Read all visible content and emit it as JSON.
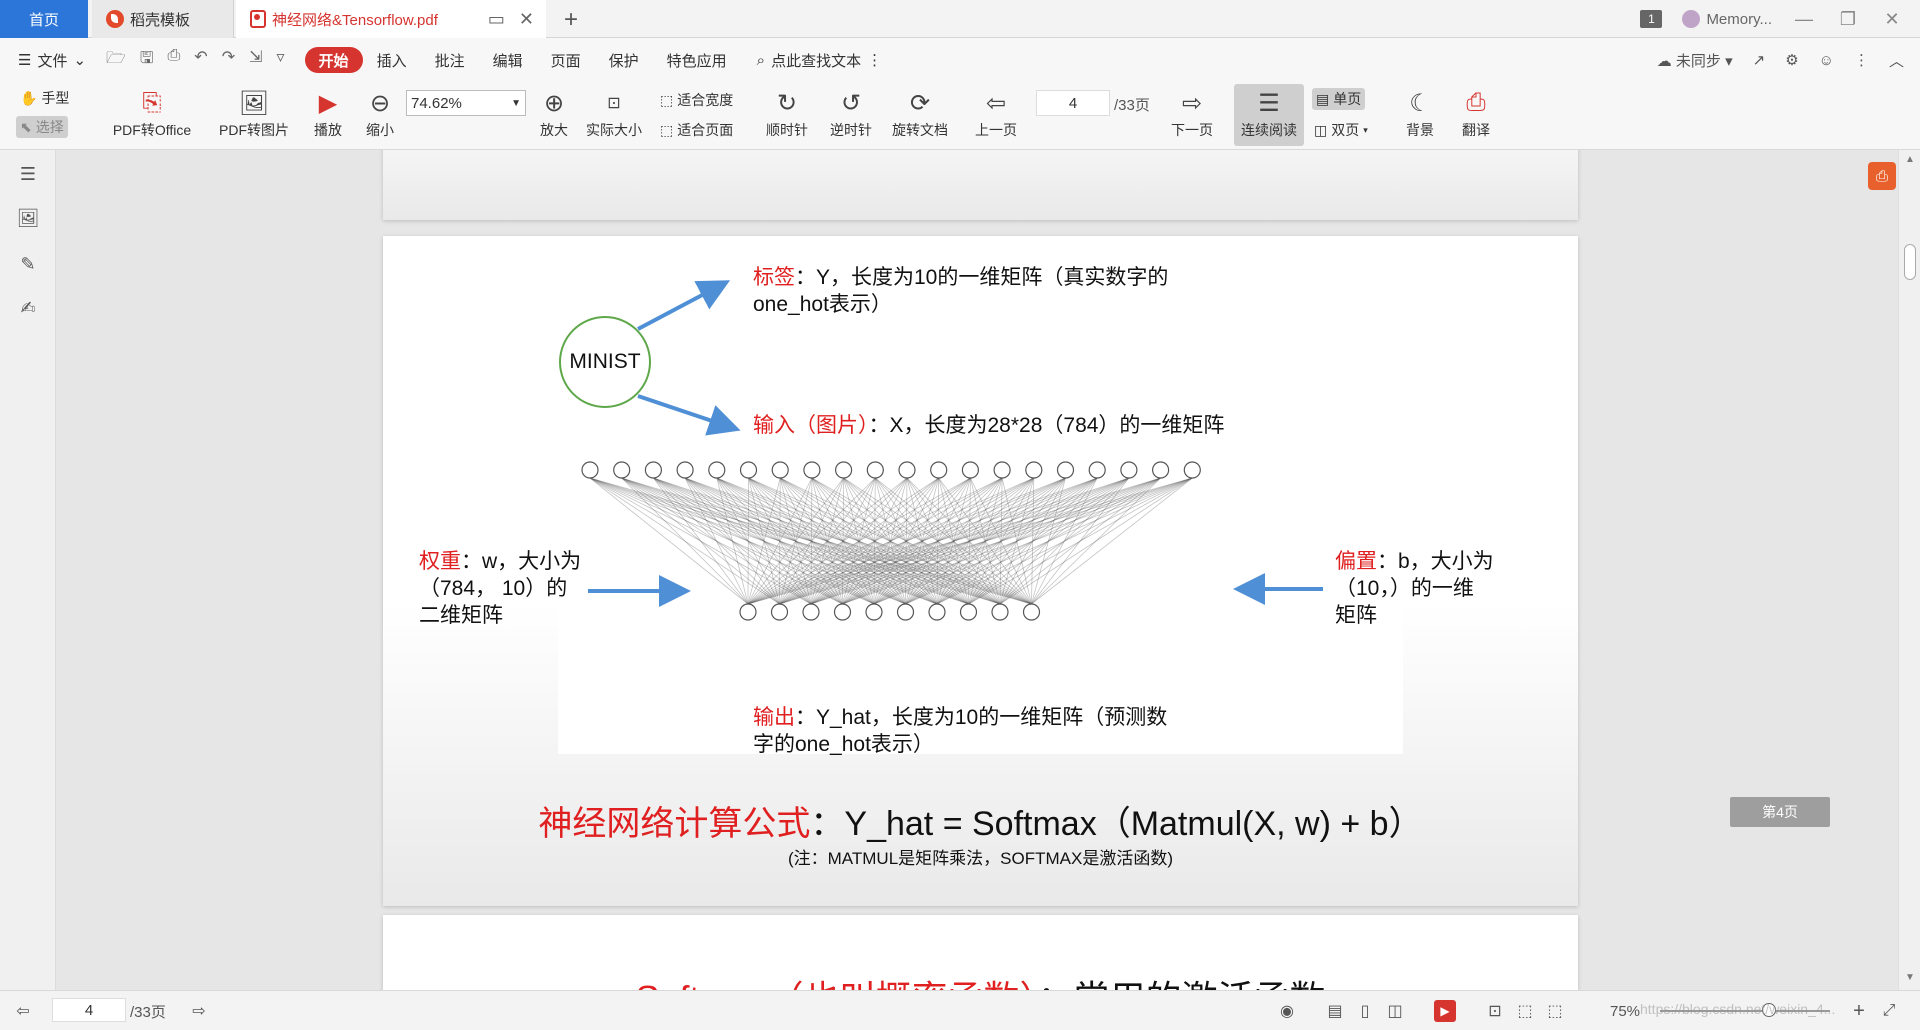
{
  "tabs": {
    "home": "首页",
    "template": "稻壳模板",
    "document": "神经网络&Tensorflow.pdf",
    "badge": "1",
    "account": "Memory..."
  },
  "menubar": {
    "file": "文件",
    "items": [
      "开始",
      "插入",
      "批注",
      "编辑",
      "页面",
      "保护",
      "特色应用"
    ],
    "search": "点此查找文本",
    "sync": "未同步"
  },
  "ribbon": {
    "hand": "手型",
    "select": "选择",
    "pdf_to_office": "PDF转Office",
    "pdf_to_image": "PDF转图片",
    "play": "播放",
    "zoom_out": "缩小",
    "zoom_value": "74.62%",
    "zoom_in": "放大",
    "actual_size": "实际大小",
    "fit_width": "适合宽度",
    "fit_page": "适合页面",
    "rotate_cw": "顺时针",
    "rotate_ccw": "逆时针",
    "rotate_doc": "旋转文档",
    "prev_page": "上一页",
    "page_value": "4",
    "page_total": "/33页",
    "next_page": "下一页",
    "continuous": "连续阅读",
    "single": "单页",
    "double": "双页",
    "background": "背景",
    "translate": "翻译"
  },
  "page": {
    "minist": "MINIST",
    "label_red": "标签",
    "label_text": "：Y，长度为10的一维矩阵（真实数字的",
    "label_text2": "one_hot表示）",
    "input_red": "输入（图片）",
    "input_text": "：X，长度为28*28（784）的一维矩阵",
    "weight_red": "权重",
    "weight_text": "：w，大小为",
    "weight_text2": "（784， 10）的",
    "weight_text3": "二维矩阵",
    "bias_red": "偏置",
    "bias_text": "：b，大小为",
    "bias_text2": "（10，）的一维",
    "bias_text3": "矩阵",
    "output_red": "输出",
    "output_text": "：Y_hat，长度为10的一维矩阵（预测数",
    "output_text2": "字的one_hot表示）",
    "formula_red": "神经网络计算公式",
    "formula_text": "：Y_hat = Softmax（Matmul(X, w) + b）",
    "note": "(注：MATMUL是矩阵乘法，SOFTMAX是激活函数)",
    "next_title_red": "Softmax（也叫概率函数）",
    "next_title_text": "：常用的激活函数",
    "page_tag": "第4页"
  },
  "statusbar": {
    "page_value": "4",
    "page_total": "/33页",
    "zoom": "75%",
    "watermark": "https://blog.csdn.net/weixin_4..."
  },
  "network": {
    "input_nodes": 20,
    "output_nodes": 10
  },
  "colors": {
    "accent": "#d6342f",
    "tab_home": "#2b76d8",
    "arrow": "#4f8fd6",
    "circle": "#5ea84a",
    "red_text": "#e02020"
  }
}
